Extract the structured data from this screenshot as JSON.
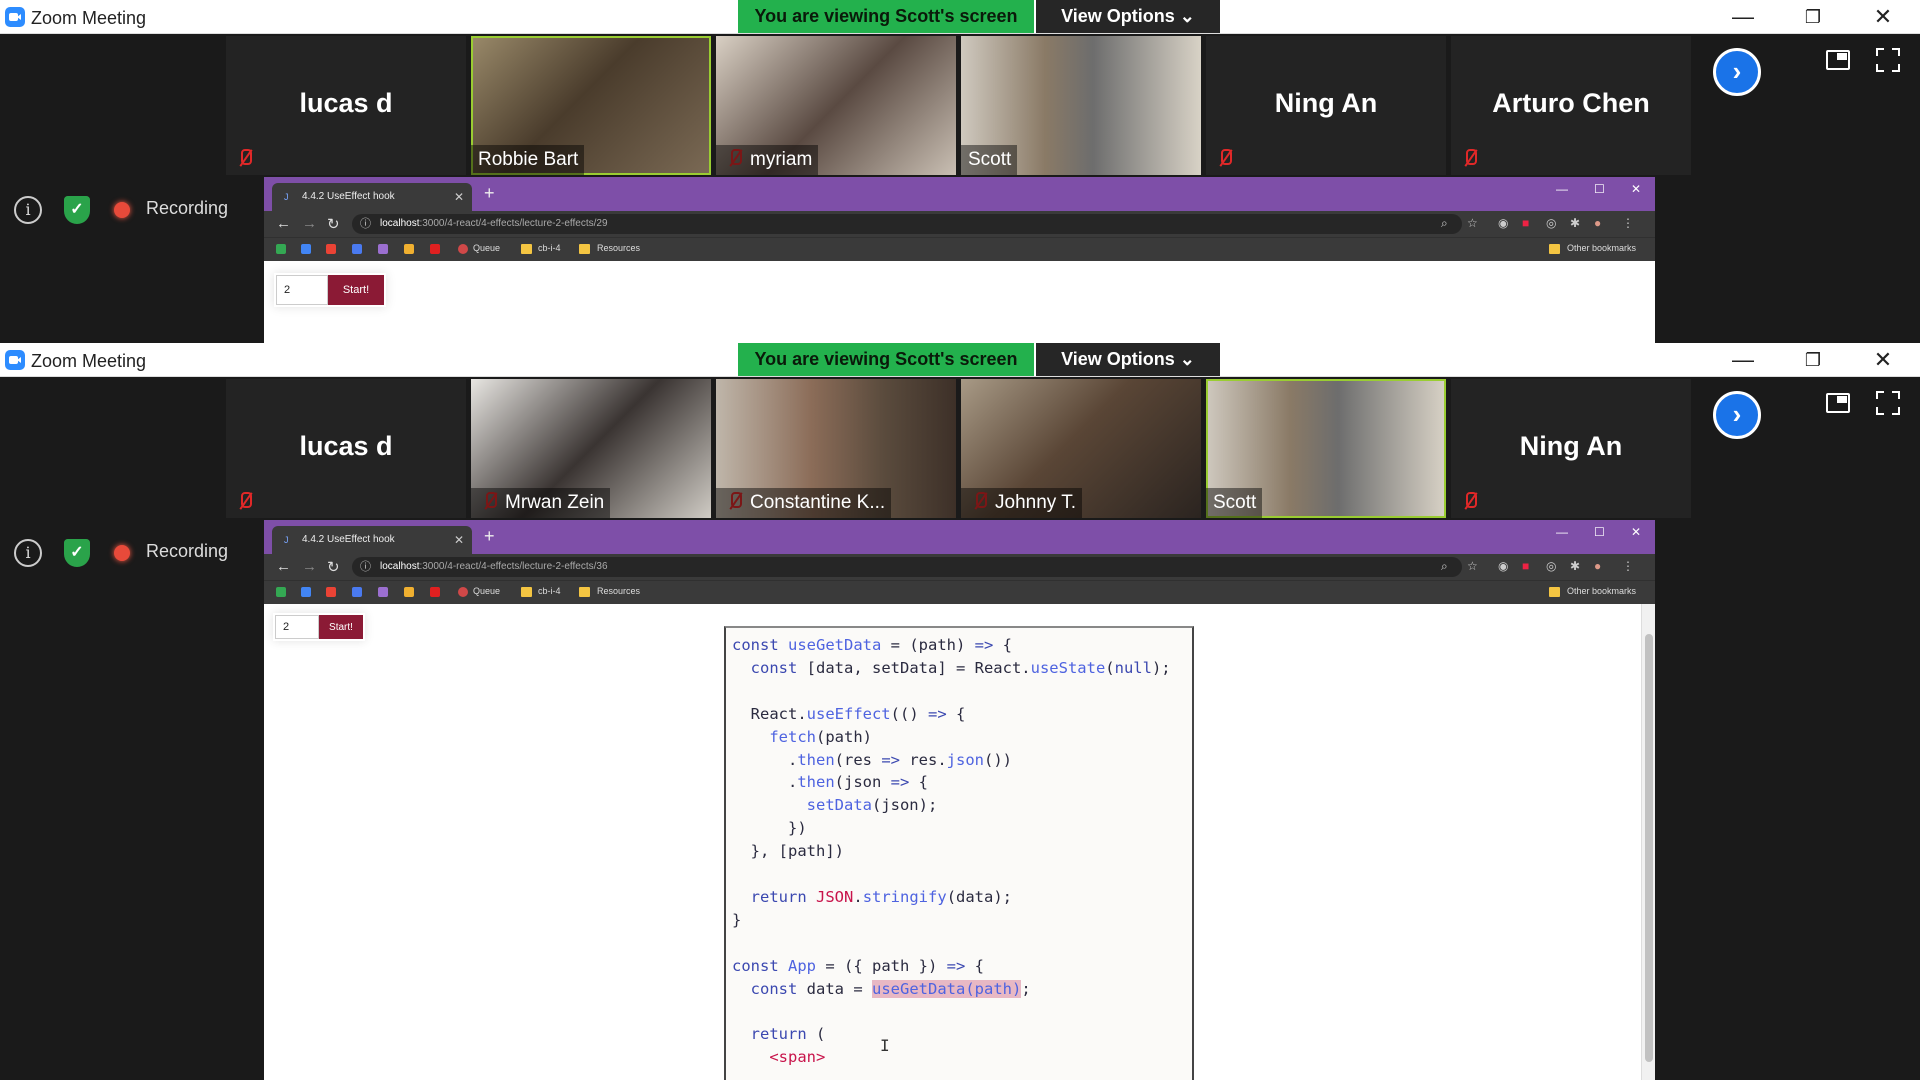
{
  "windows": [
    {
      "app_title": "Zoom Meeting",
      "share_banner": "You are viewing Scott's screen",
      "view_options": "View Options",
      "name_tiles": [
        {
          "name": "lucas d",
          "slot": 0
        },
        {
          "name": "Ning An",
          "slot": 4
        },
        {
          "name": "Arturo Chen",
          "slot": 5
        }
      ],
      "video_tiles": [
        {
          "name": "Robbie Bart",
          "slot": 1,
          "muted": false,
          "speaking": true
        },
        {
          "name": "myriam",
          "slot": 2,
          "muted": true,
          "speaking": false
        },
        {
          "name": "Scott",
          "slot": 3,
          "muted": false,
          "speaking": false
        }
      ],
      "recording_label": "Recording",
      "browser": {
        "tab_title": "4.4.2 UseEffect hook",
        "url_host": "localhost",
        "url_rest": ":3000/4-react/4-effects/lecture-2-effects/29",
        "bookmarks": [
          "Queue",
          "cb-i-4",
          "Resources"
        ],
        "other_bookmarks": "Other bookmarks",
        "input_value": "2",
        "start_label": "Start!"
      }
    },
    {
      "app_title": "Zoom Meeting",
      "share_banner": "You are viewing Scott's screen",
      "view_options": "View Options",
      "name_tiles": [
        {
          "name": "lucas d",
          "slot": 0
        },
        {
          "name": "Ning An",
          "slot": 5
        }
      ],
      "video_tiles": [
        {
          "name": "Mrwan Zein",
          "slot": 1,
          "muted": true,
          "speaking": false
        },
        {
          "name": "Constantine K...",
          "slot": 2,
          "muted": true,
          "speaking": false
        },
        {
          "name": "Johnny T.",
          "slot": 3,
          "muted": true,
          "speaking": false
        },
        {
          "name": "Scott",
          "slot": 4,
          "muted": false,
          "speaking": true
        }
      ],
      "recording_label": "Recording",
      "browser": {
        "tab_title": "4.4.2 UseEffect hook",
        "url_host": "localhost",
        "url_rest": ":3000/4-react/4-effects/lecture-2-effects/36",
        "bookmarks": [
          "Queue",
          "cb-i-4",
          "Resources"
        ],
        "other_bookmarks": "Other bookmarks",
        "input_value": "2",
        "start_label": "Start!",
        "code_lines": [
          "const useGetData = (path) => {",
          "  const [data, setData] = React.useState(null);",
          "",
          "  React.useEffect(() => {",
          "    fetch(path)",
          "      .then(res => res.json())",
          "      .then(json => {",
          "        setData(json);",
          "      })",
          "  }, [path])",
          "",
          "  return JSON.stringify(data);",
          "}",
          "",
          "const App = ({ path }) => {",
          "  const data = useGetData(path);",
          "",
          "  return (",
          "    <span>"
        ]
      }
    }
  ],
  "colors": {
    "share_banner_bg": "#23b14d",
    "browser_tab_bar": "#7e4fa8",
    "start_button": "#8b1a35",
    "speaking_outline": "#9acd32",
    "muted_icon": "#e02828",
    "next_button": "#1a73e8"
  },
  "icons": [
    "zoom-logo-icon",
    "minimize-icon",
    "restore-icon",
    "close-icon",
    "mic-muted-icon",
    "chevron-right-icon",
    "gallery-view-icon",
    "fullscreen-icon",
    "info-icon",
    "shield-check-icon",
    "record-dot-icon",
    "chevron-down-icon",
    "back-arrow-icon",
    "forward-arrow-icon",
    "reload-icon",
    "zoom-icon",
    "star-icon",
    "extensions-icon",
    "profile-icon",
    "menu-icon",
    "folder-icon",
    "text-cursor-icon"
  ]
}
